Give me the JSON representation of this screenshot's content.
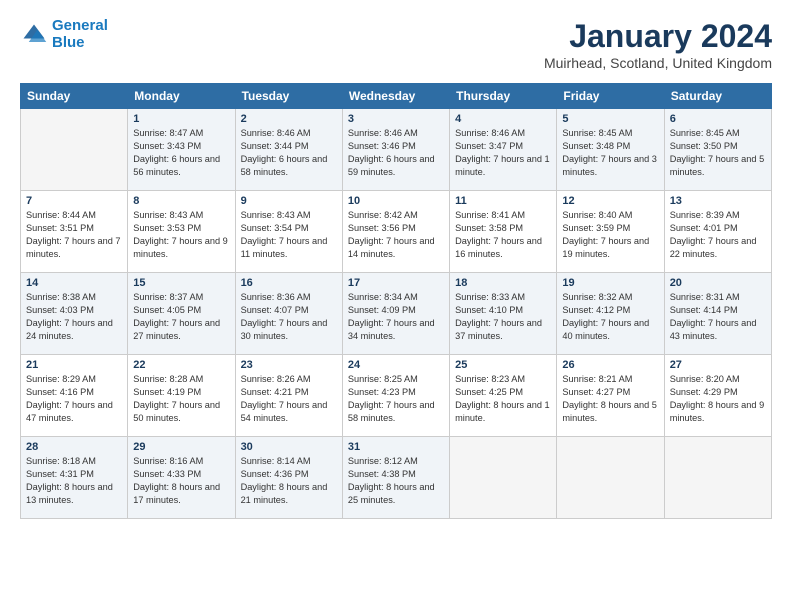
{
  "header": {
    "logo_line1": "General",
    "logo_line2": "Blue",
    "month_title": "January 2024",
    "location": "Muirhead, Scotland, United Kingdom"
  },
  "weekdays": [
    "Sunday",
    "Monday",
    "Tuesday",
    "Wednesday",
    "Thursday",
    "Friday",
    "Saturday"
  ],
  "weeks": [
    [
      {
        "day": "",
        "sunrise": "",
        "sunset": "",
        "daylight": "",
        "empty": true
      },
      {
        "day": "1",
        "sunrise": "Sunrise: 8:47 AM",
        "sunset": "Sunset: 3:43 PM",
        "daylight": "Daylight: 6 hours and 56 minutes.",
        "empty": false
      },
      {
        "day": "2",
        "sunrise": "Sunrise: 8:46 AM",
        "sunset": "Sunset: 3:44 PM",
        "daylight": "Daylight: 6 hours and 58 minutes.",
        "empty": false
      },
      {
        "day": "3",
        "sunrise": "Sunrise: 8:46 AM",
        "sunset": "Sunset: 3:46 PM",
        "daylight": "Daylight: 6 hours and 59 minutes.",
        "empty": false
      },
      {
        "day": "4",
        "sunrise": "Sunrise: 8:46 AM",
        "sunset": "Sunset: 3:47 PM",
        "daylight": "Daylight: 7 hours and 1 minute.",
        "empty": false
      },
      {
        "day": "5",
        "sunrise": "Sunrise: 8:45 AM",
        "sunset": "Sunset: 3:48 PM",
        "daylight": "Daylight: 7 hours and 3 minutes.",
        "empty": false
      },
      {
        "day": "6",
        "sunrise": "Sunrise: 8:45 AM",
        "sunset": "Sunset: 3:50 PM",
        "daylight": "Daylight: 7 hours and 5 minutes.",
        "empty": false
      }
    ],
    [
      {
        "day": "7",
        "sunrise": "Sunrise: 8:44 AM",
        "sunset": "Sunset: 3:51 PM",
        "daylight": "Daylight: 7 hours and 7 minutes.",
        "empty": false
      },
      {
        "day": "8",
        "sunrise": "Sunrise: 8:43 AM",
        "sunset": "Sunset: 3:53 PM",
        "daylight": "Daylight: 7 hours and 9 minutes.",
        "empty": false
      },
      {
        "day": "9",
        "sunrise": "Sunrise: 8:43 AM",
        "sunset": "Sunset: 3:54 PM",
        "daylight": "Daylight: 7 hours and 11 minutes.",
        "empty": false
      },
      {
        "day": "10",
        "sunrise": "Sunrise: 8:42 AM",
        "sunset": "Sunset: 3:56 PM",
        "daylight": "Daylight: 7 hours and 14 minutes.",
        "empty": false
      },
      {
        "day": "11",
        "sunrise": "Sunrise: 8:41 AM",
        "sunset": "Sunset: 3:58 PM",
        "daylight": "Daylight: 7 hours and 16 minutes.",
        "empty": false
      },
      {
        "day": "12",
        "sunrise": "Sunrise: 8:40 AM",
        "sunset": "Sunset: 3:59 PM",
        "daylight": "Daylight: 7 hours and 19 minutes.",
        "empty": false
      },
      {
        "day": "13",
        "sunrise": "Sunrise: 8:39 AM",
        "sunset": "Sunset: 4:01 PM",
        "daylight": "Daylight: 7 hours and 22 minutes.",
        "empty": false
      }
    ],
    [
      {
        "day": "14",
        "sunrise": "Sunrise: 8:38 AM",
        "sunset": "Sunset: 4:03 PM",
        "daylight": "Daylight: 7 hours and 24 minutes.",
        "empty": false
      },
      {
        "day": "15",
        "sunrise": "Sunrise: 8:37 AM",
        "sunset": "Sunset: 4:05 PM",
        "daylight": "Daylight: 7 hours and 27 minutes.",
        "empty": false
      },
      {
        "day": "16",
        "sunrise": "Sunrise: 8:36 AM",
        "sunset": "Sunset: 4:07 PM",
        "daylight": "Daylight: 7 hours and 30 minutes.",
        "empty": false
      },
      {
        "day": "17",
        "sunrise": "Sunrise: 8:34 AM",
        "sunset": "Sunset: 4:09 PM",
        "daylight": "Daylight: 7 hours and 34 minutes.",
        "empty": false
      },
      {
        "day": "18",
        "sunrise": "Sunrise: 8:33 AM",
        "sunset": "Sunset: 4:10 PM",
        "daylight": "Daylight: 7 hours and 37 minutes.",
        "empty": false
      },
      {
        "day": "19",
        "sunrise": "Sunrise: 8:32 AM",
        "sunset": "Sunset: 4:12 PM",
        "daylight": "Daylight: 7 hours and 40 minutes.",
        "empty": false
      },
      {
        "day": "20",
        "sunrise": "Sunrise: 8:31 AM",
        "sunset": "Sunset: 4:14 PM",
        "daylight": "Daylight: 7 hours and 43 minutes.",
        "empty": false
      }
    ],
    [
      {
        "day": "21",
        "sunrise": "Sunrise: 8:29 AM",
        "sunset": "Sunset: 4:16 PM",
        "daylight": "Daylight: 7 hours and 47 minutes.",
        "empty": false
      },
      {
        "day": "22",
        "sunrise": "Sunrise: 8:28 AM",
        "sunset": "Sunset: 4:19 PM",
        "daylight": "Daylight: 7 hours and 50 minutes.",
        "empty": false
      },
      {
        "day": "23",
        "sunrise": "Sunrise: 8:26 AM",
        "sunset": "Sunset: 4:21 PM",
        "daylight": "Daylight: 7 hours and 54 minutes.",
        "empty": false
      },
      {
        "day": "24",
        "sunrise": "Sunrise: 8:25 AM",
        "sunset": "Sunset: 4:23 PM",
        "daylight": "Daylight: 7 hours and 58 minutes.",
        "empty": false
      },
      {
        "day": "25",
        "sunrise": "Sunrise: 8:23 AM",
        "sunset": "Sunset: 4:25 PM",
        "daylight": "Daylight: 8 hours and 1 minute.",
        "empty": false
      },
      {
        "day": "26",
        "sunrise": "Sunrise: 8:21 AM",
        "sunset": "Sunset: 4:27 PM",
        "daylight": "Daylight: 8 hours and 5 minutes.",
        "empty": false
      },
      {
        "day": "27",
        "sunrise": "Sunrise: 8:20 AM",
        "sunset": "Sunset: 4:29 PM",
        "daylight": "Daylight: 8 hours and 9 minutes.",
        "empty": false
      }
    ],
    [
      {
        "day": "28",
        "sunrise": "Sunrise: 8:18 AM",
        "sunset": "Sunset: 4:31 PM",
        "daylight": "Daylight: 8 hours and 13 minutes.",
        "empty": false
      },
      {
        "day": "29",
        "sunrise": "Sunrise: 8:16 AM",
        "sunset": "Sunset: 4:33 PM",
        "daylight": "Daylight: 8 hours and 17 minutes.",
        "empty": false
      },
      {
        "day": "30",
        "sunrise": "Sunrise: 8:14 AM",
        "sunset": "Sunset: 4:36 PM",
        "daylight": "Daylight: 8 hours and 21 minutes.",
        "empty": false
      },
      {
        "day": "31",
        "sunrise": "Sunrise: 8:12 AM",
        "sunset": "Sunset: 4:38 PM",
        "daylight": "Daylight: 8 hours and 25 minutes.",
        "empty": false
      },
      {
        "day": "",
        "sunrise": "",
        "sunset": "",
        "daylight": "",
        "empty": true
      },
      {
        "day": "",
        "sunrise": "",
        "sunset": "",
        "daylight": "",
        "empty": true
      },
      {
        "day": "",
        "sunrise": "",
        "sunset": "",
        "daylight": "",
        "empty": true
      }
    ]
  ]
}
